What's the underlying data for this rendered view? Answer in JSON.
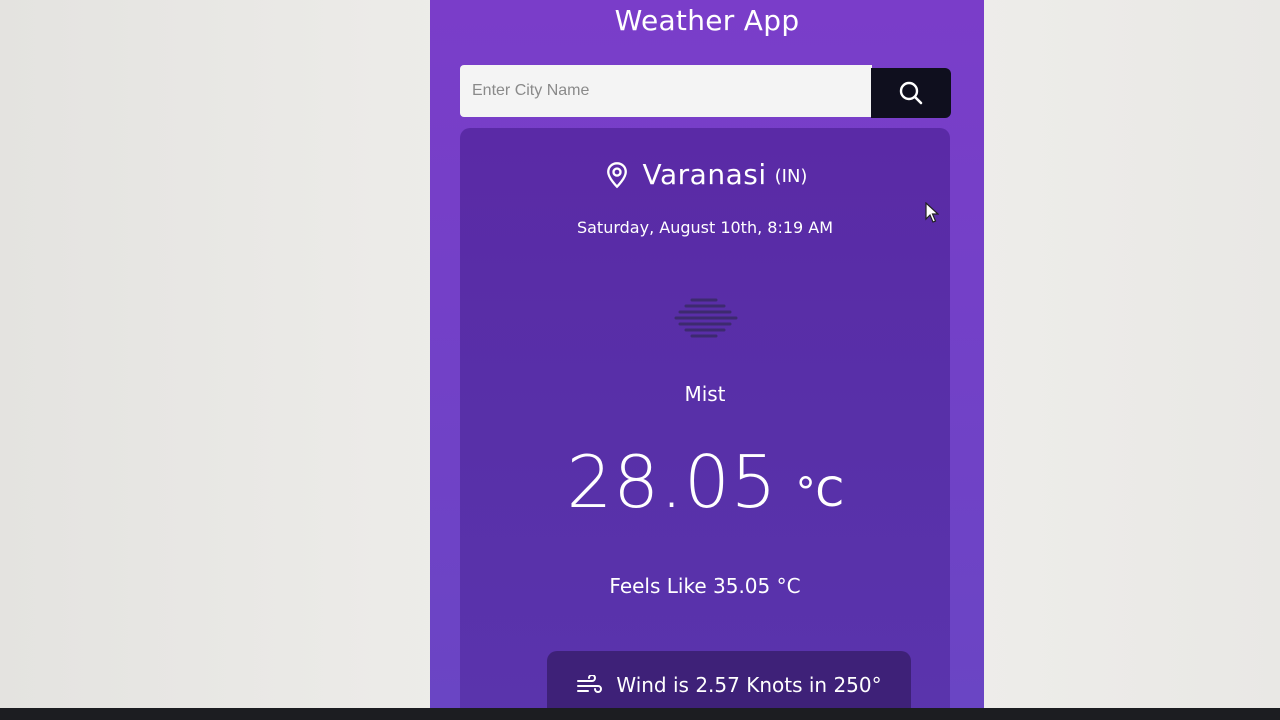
{
  "app": {
    "title": "Weather App"
  },
  "search": {
    "placeholder": "Enter City Name",
    "value": "",
    "button_icon": "search-icon"
  },
  "weather": {
    "city": "Varanasi",
    "country": "(IN)",
    "datetime": "Saturday, August 10th, 8:19 AM",
    "condition_icon": "mist-icon",
    "condition": "Mist",
    "temperature": "28.05",
    "temperature_unit": "°C",
    "feels_like": "Feels Like 35.05 °C",
    "wind": "Wind is 2.57 Knots in 250°"
  },
  "colors": {
    "app_background": "#7440c8",
    "card_background": "#5830a8",
    "wind_box_background": "#3e2178",
    "search_button": "#0f0f1e",
    "text": "#ffffff"
  }
}
